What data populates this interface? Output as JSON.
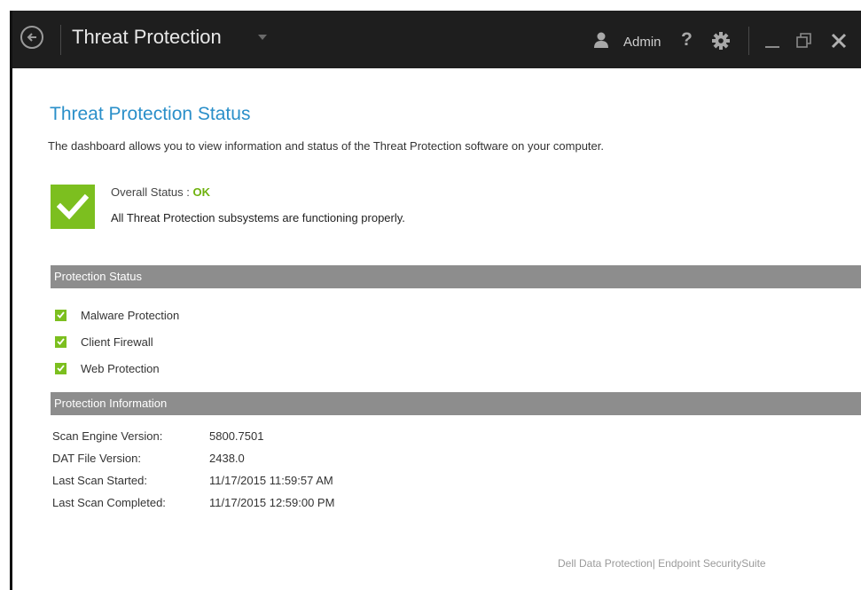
{
  "titlebar": {
    "app_title": "Threat Protection",
    "user_name": "Admin",
    "help_label": "?"
  },
  "page": {
    "title": "Threat Protection Status",
    "description": "The dashboard allows you to view information and status of the Threat Protection software on your computer."
  },
  "overall": {
    "label": "Overall Status :",
    "value": "OK",
    "detail": "All Threat Protection subsystems are functioning properly."
  },
  "protection_status": {
    "header": "Protection Status",
    "items": [
      {
        "label": "Malware Protection",
        "checked": true
      },
      {
        "label": "Client Firewall",
        "checked": true
      },
      {
        "label": "Web Protection",
        "checked": true
      }
    ]
  },
  "protection_info": {
    "header": "Protection Information",
    "rows": [
      {
        "label": "Scan Engine Version:",
        "value": "5800.7501"
      },
      {
        "label": "DAT File Version:",
        "value": "2438.0"
      },
      {
        "label": "Last Scan Started:",
        "value": "11/17/2015 11:59:57 AM"
      },
      {
        "label": "Last Scan Completed:",
        "value": "11/17/2015 12:59:00 PM"
      }
    ]
  },
  "footer": {
    "brand": "Dell Data Protection| Endpoint SecuritySuite"
  },
  "colors": {
    "titlebar_bg": "#1e1e1e",
    "accent_blue": "#2a8fc9",
    "status_green": "#7cbf1f",
    "section_header_bg": "#8d8d8d"
  },
  "icons": {
    "back": "back-arrow-circle-icon",
    "dropdown": "caret-down-icon",
    "user": "user-icon",
    "help": "question-mark-icon",
    "settings": "gear-icon",
    "minimize": "minimize-icon",
    "restore": "restore-icon",
    "close": "close-icon",
    "status_ok": "checkmark-icon"
  }
}
